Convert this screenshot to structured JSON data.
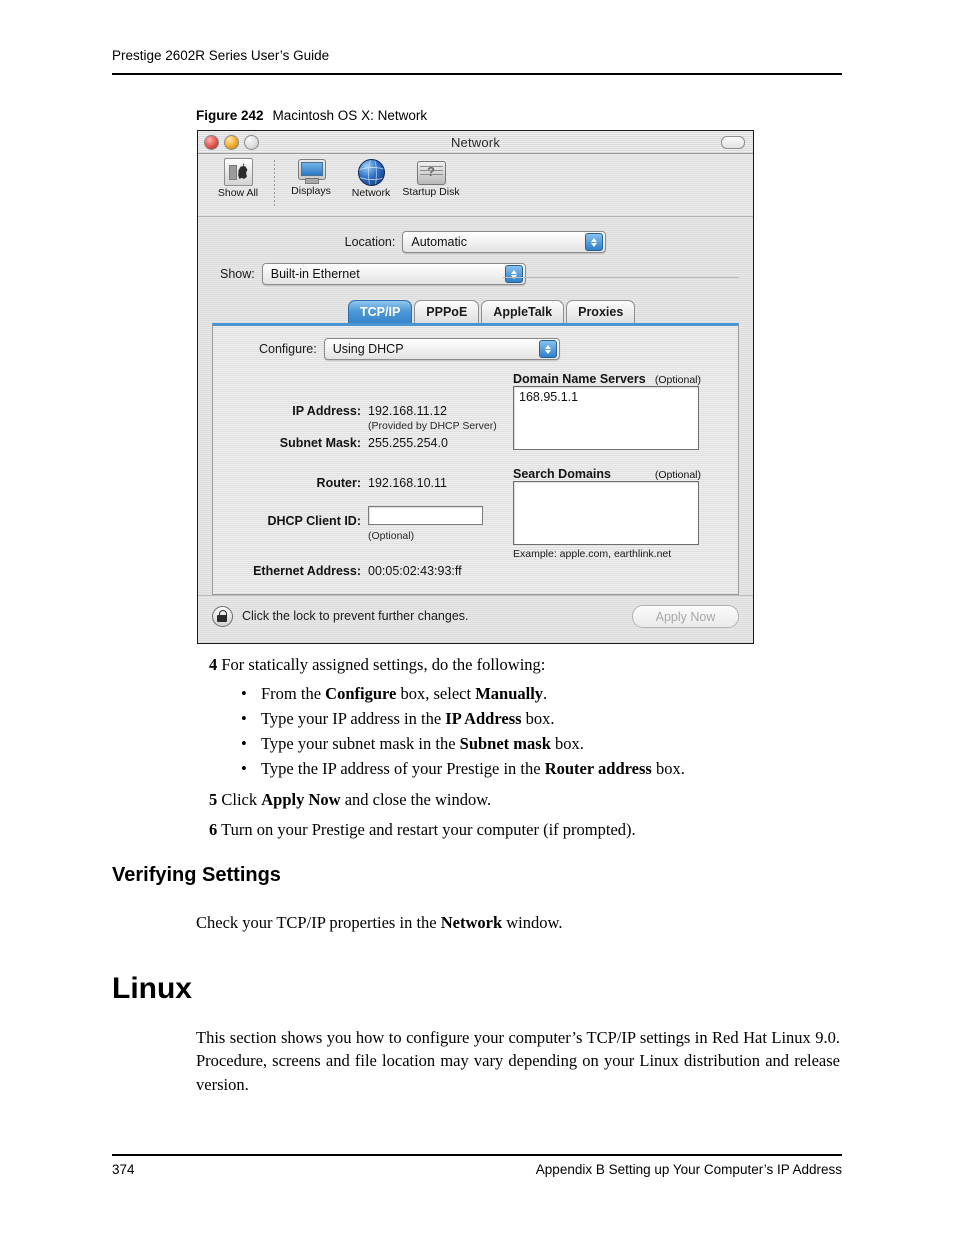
{
  "document": {
    "running_header": "Prestige 2602R Series User’s Guide",
    "footer_page_number": "374",
    "footer_text": "Appendix B Setting up Your Computer’s IP Address"
  },
  "figure": {
    "number": "Figure 242",
    "title": "Macintosh OS X: Network"
  },
  "mac_window": {
    "title": "Network",
    "traffic_lights": [
      "close-button",
      "minimize-button",
      "zoom-button"
    ],
    "toolbar": {
      "items": [
        {
          "label": "Show All",
          "icon": "show-all-icon"
        },
        {
          "label": "Displays",
          "icon": "display-icon"
        },
        {
          "label": "Network",
          "icon": "globe-icon"
        },
        {
          "label": "Startup Disk",
          "icon": "startup-disk-icon"
        }
      ]
    },
    "location": {
      "label": "Location:",
      "value": "Automatic"
    },
    "show": {
      "label": "Show:",
      "value": "Built-in Ethernet"
    },
    "tabs": [
      {
        "label": "TCP/IP",
        "active": true
      },
      {
        "label": "PPPoE",
        "active": false
      },
      {
        "label": "AppleTalk",
        "active": false
      },
      {
        "label": "Proxies",
        "active": false
      }
    ],
    "tcpip": {
      "configure": {
        "label": "Configure:",
        "value": "Using DHCP"
      },
      "ip_address": {
        "label": "IP Address:",
        "value": "192.168.11.12",
        "note": "(Provided by DHCP Server)"
      },
      "subnet_mask": {
        "label": "Subnet Mask:",
        "value": "255.255.254.0"
      },
      "router": {
        "label": "Router:",
        "value": "192.168.10.11"
      },
      "dhcp_client_id": {
        "label": "DHCP Client ID:",
        "value": "",
        "note": "(Optional)"
      },
      "ethernet_address": {
        "label": "Ethernet Address:",
        "value": "00:05:02:43:93:ff"
      },
      "dns": {
        "label": "Domain Name Servers",
        "optional": "(Optional)",
        "value": "168.95.1.1"
      },
      "search_domains": {
        "label": "Search Domains",
        "optional": "(Optional)",
        "value": "",
        "example": "Example: apple.com, earthlink.net"
      }
    },
    "footer": {
      "lock_icon": "lock-icon",
      "lock_message": "Click the lock to prevent further changes.",
      "apply_button": "Apply Now"
    }
  },
  "steps": {
    "step4": {
      "num": "4",
      "text": "For statically assigned settings, do the following:"
    },
    "bullets": [
      {
        "dot": "•",
        "pre": "From the ",
        "b1": "Configure",
        "mid": " box, select ",
        "b2": "Manually",
        "post": "."
      },
      {
        "dot": "•",
        "pre": "Type your IP address in the ",
        "b1": "IP Address",
        "mid": "",
        "b2": "",
        "post": " box."
      },
      {
        "dot": "•",
        "pre": "Type your subnet mask in the ",
        "b1": "Subnet mask",
        "mid": "",
        "b2": "",
        "post": " box."
      },
      {
        "dot": "•",
        "pre": "Type the IP address of your Prestige in the ",
        "b1": "Router address",
        "mid": "",
        "b2": "",
        "post": " box."
      }
    ],
    "step5": {
      "num": "5",
      "pre": "Click ",
      "bold": "Apply Now",
      "post": " and close the window."
    },
    "step6": {
      "num": "6",
      "text": "Turn on your Prestige and restart your computer (if prompted)."
    }
  },
  "sections": {
    "verifying_heading": "Verifying Settings",
    "verifying_pre": "Check your TCP/IP properties in the ",
    "verifying_bold": "Network",
    "verifying_post": " window.",
    "linux_heading": "Linux",
    "linux_paragraph": "This section shows you how to configure your computer’s TCP/IP settings in Red Hat Linux 9.0. Procedure, screens and file location may vary depending on your Linux distribution and release version."
  }
}
